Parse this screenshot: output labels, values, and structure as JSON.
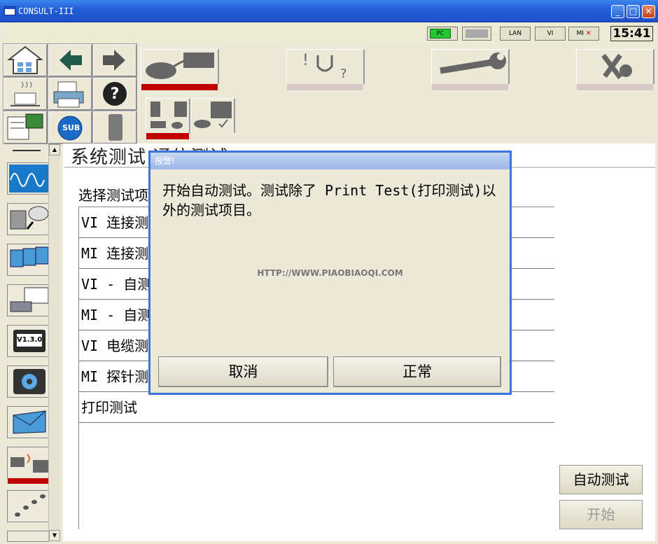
{
  "window": {
    "title": "CONSULT-III",
    "minimize": "_",
    "maximize": "□",
    "close": "✕"
  },
  "status": {
    "pc": "PC",
    "lan": "LAN",
    "vi": "VI",
    "mi": "MI",
    "time": "15:41"
  },
  "side": {
    "sub_label": "SUB",
    "version_label": "V1.3.0",
    "scroll_up": "▲",
    "scroll_down": "▼"
  },
  "content": {
    "heading": "系统测试 通信测试",
    "select_label": "选择测试项",
    "rows": [
      "VI 连接测试",
      "MI 连接测试",
      "VI - 自测试",
      "MI - 自测试",
      "VI 电缆测试",
      "MI 探针测试",
      "打印测试"
    ],
    "auto_test_button": "自动测试",
    "start_button": "开始"
  },
  "dialog": {
    "title": "报警!",
    "message": "开始自动测试。测试除了 Print Test(打印测试)以外的测试项目。",
    "watermark": "HTTP://WWW.PIAOBIAOQI.COM",
    "cancel": "取消",
    "ok": "正常"
  },
  "colors": {
    "active_tab": "#c00000",
    "title_bar": "#2360d8",
    "pc_ok": "#23c72e"
  }
}
